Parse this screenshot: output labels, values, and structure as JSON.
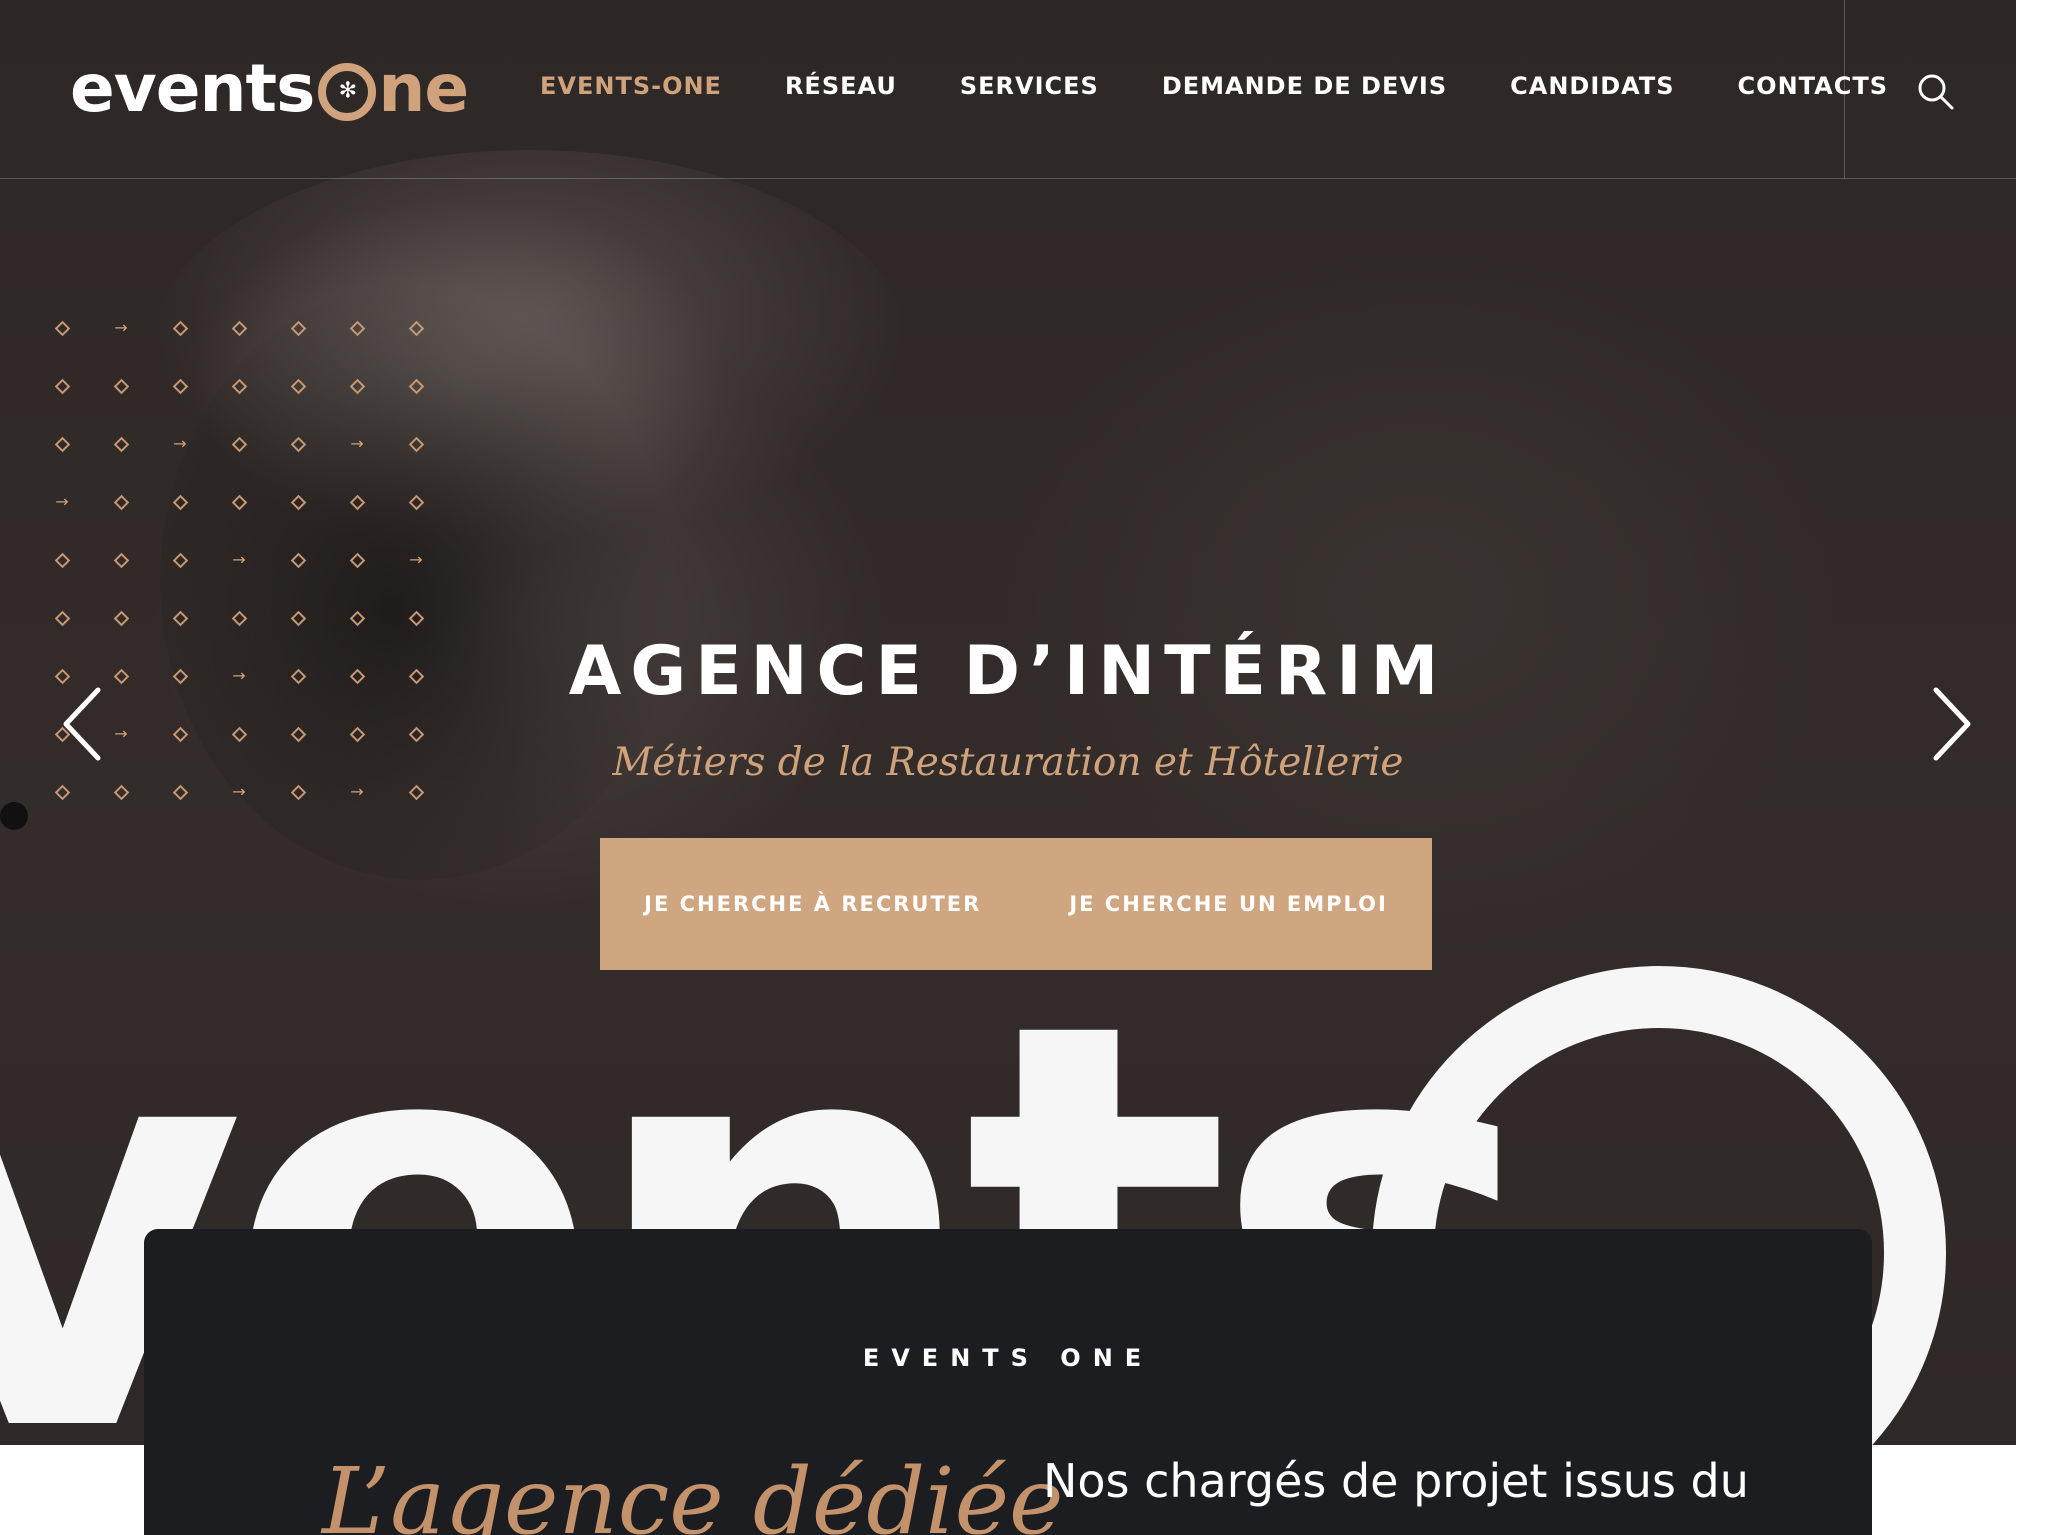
{
  "brand": {
    "logo_left": "events",
    "logo_right": "ne",
    "logo_star": "✻",
    "accent_color": "#d0a27c"
  },
  "nav": {
    "items": [
      {
        "label": "EVENTS-ONE",
        "active": true
      },
      {
        "label": "RÉSEAU",
        "active": false
      },
      {
        "label": "SERVICES",
        "active": false
      },
      {
        "label": "DEMANDE DE DEVIS",
        "active": false
      },
      {
        "label": "CANDIDATS",
        "active": false
      },
      {
        "label": "CONTACTS",
        "active": false
      }
    ],
    "search_icon": "search-icon"
  },
  "hero": {
    "title": "AGENCE D’INTÉRIM",
    "subtitle": "Métiers de la Restauration et Hôtellerie",
    "cta_recruit": "JE CHERCHE À RECRUTER",
    "cta_job": "JE CHERCHE UN EMPLOI",
    "prev_icon": "chevron-left-icon",
    "next_icon": "chevron-right-icon",
    "big_wordmark": "vents"
  },
  "section": {
    "eyebrow": "EVENTS ONE",
    "heading": "L’agence dédiée",
    "body": "Nos chargés de projet issus du"
  }
}
